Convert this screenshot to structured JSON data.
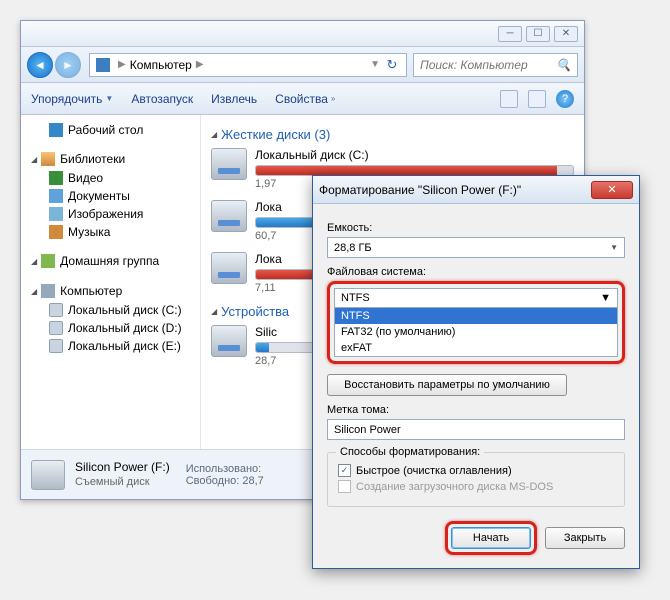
{
  "explorer": {
    "breadcrumb": {
      "root_icon": "computer",
      "item": "Компьютер"
    },
    "search_placeholder": "Поиск: Компьютер",
    "toolbar": {
      "organize": "Упорядочить",
      "autoplay": "Автозапуск",
      "eject": "Извлечь",
      "properties": "Свойства"
    },
    "sidebar": {
      "desktop": "Рабочий стол",
      "libraries": "Библиотеки",
      "lib_items": [
        "Видео",
        "Документы",
        "Изображения",
        "Музыка"
      ],
      "homegroup": "Домашняя группа",
      "computer": "Компьютер",
      "drives": [
        "Локальный диск (C:)",
        "Локальный диск (D:)",
        "Локальный диск (E:)"
      ]
    },
    "main": {
      "hdd_header": "Жесткие диски (3)",
      "drive_c": {
        "name": "Локальный диск (C:)",
        "sub": "1,97"
      },
      "drive_d": {
        "name": "Лока",
        "sub": "60,7"
      },
      "drive_e": {
        "name": "Лока",
        "sub": "7,11"
      },
      "dev_header": "Устройства",
      "dev1": {
        "name": "Silic",
        "sub": "28,7"
      }
    },
    "status": {
      "name": "Silicon Power (F:)",
      "type": "Съемный диск",
      "used_label": "Использовано:",
      "free_label": "Свободно:",
      "free_value": "28,7"
    }
  },
  "format": {
    "title": "Форматирование \"Silicon Power (F:)\"",
    "capacity_label": "Емкость:",
    "capacity_value": "28,8 ГБ",
    "fs_label": "Файловая система:",
    "fs_selected": "NTFS",
    "fs_options": [
      "NTFS",
      "FAT32 (по умолчанию)",
      "exFAT"
    ],
    "restore_btn": "Восстановить параметры по умолчанию",
    "volume_label_label": "Метка тома:",
    "volume_label_value": "Silicon Power",
    "methods_group": "Способы форматирования:",
    "quick_check": "Быстрое (очистка оглавления)",
    "msdos_check": "Создание загрузочного диска MS-DOS",
    "start_btn": "Начать",
    "close_btn": "Закрыть"
  }
}
